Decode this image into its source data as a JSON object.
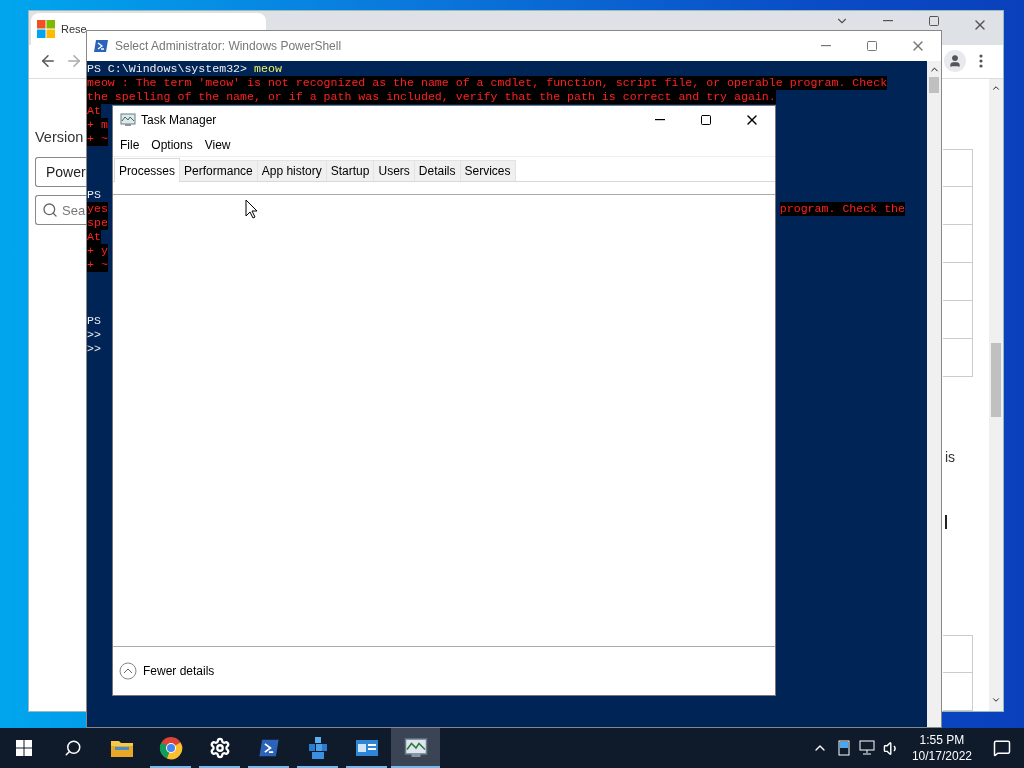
{
  "browser": {
    "tab": {
      "title": "Rese"
    },
    "heading": "Version",
    "dropdown": {
      "value": "Power"
    },
    "search": {
      "placeholder": "Sea"
    },
    "side_text": "is"
  },
  "powershell": {
    "title": "Select Administrator: Windows PowerShell",
    "lines": [
      {
        "kind": "prompt",
        "text": "PS C:\\Windows\\system32>",
        "command": "meow"
      },
      {
        "kind": "error",
        "text": "meow : The term 'meow' is not recognized as the name of a cmdlet, function, script file, or operable program. Check"
      },
      {
        "kind": "error",
        "text": "the spelling of the name, or if a path was included, verify that the path is correct and try again."
      },
      {
        "kind": "error",
        "text": "At"
      },
      {
        "kind": "error",
        "text": "+ m"
      },
      {
        "kind": "error",
        "text": "+ ~"
      },
      {
        "kind": "blank"
      },
      {
        "kind": "blank"
      },
      {
        "kind": "blank"
      },
      {
        "kind": "prompt",
        "text": "PS"
      },
      {
        "kind": "error",
        "text": "yes",
        "right": "program. Check the"
      },
      {
        "kind": "error",
        "text": "spe"
      },
      {
        "kind": "error",
        "text": "At"
      },
      {
        "kind": "error",
        "text": "+ y"
      },
      {
        "kind": "error",
        "text": "+ ~"
      },
      {
        "kind": "blank"
      },
      {
        "kind": "blank"
      },
      {
        "kind": "blank"
      },
      {
        "kind": "prompt",
        "text": "PS"
      },
      {
        "kind": "prompt",
        "text": ">>"
      },
      {
        "kind": "prompt",
        "text": ">>"
      }
    ]
  },
  "task_manager": {
    "title": "Task Manager",
    "menu": [
      "File",
      "Options",
      "View"
    ],
    "tabs": [
      {
        "label": "Processes",
        "selected": true
      },
      {
        "label": "Performance",
        "selected": false
      },
      {
        "label": "App history",
        "selected": false
      },
      {
        "label": "Startup",
        "selected": false
      },
      {
        "label": "Users",
        "selected": false
      },
      {
        "label": "Details",
        "selected": false
      },
      {
        "label": "Services",
        "selected": false
      }
    ],
    "footer": "Fewer details"
  },
  "taskbar": {
    "apps": [
      {
        "kind": "explorer",
        "running": false,
        "active": false
      },
      {
        "kind": "chrome",
        "running": true,
        "active": false
      },
      {
        "kind": "settings",
        "running": true,
        "active": false
      },
      {
        "kind": "powershell",
        "running": true,
        "active": false
      },
      {
        "kind": "blocks",
        "running": true,
        "active": false
      },
      {
        "kind": "card",
        "running": true,
        "active": false
      },
      {
        "kind": "taskmgr",
        "running": true,
        "active": true
      }
    ],
    "time": "1:55 PM",
    "date": "10/17/2022"
  }
}
